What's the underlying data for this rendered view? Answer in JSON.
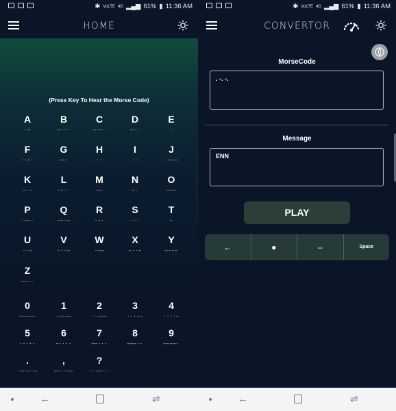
{
  "status": {
    "battery": "61%",
    "time": "11:36 AM",
    "net": "4G",
    "volte": "VoLTE"
  },
  "home": {
    "title": "HOME",
    "hint": "(Press Key To Hear the Morse Code)",
    "keys": [
      {
        "ch": "A",
        "mc": "·−"
      },
      {
        "ch": "B",
        "mc": "−···"
      },
      {
        "ch": "C",
        "mc": "−·−·"
      },
      {
        "ch": "D",
        "mc": "−··"
      },
      {
        "ch": "E",
        "mc": "·"
      },
      {
        "ch": "F",
        "mc": "··−·"
      },
      {
        "ch": "G",
        "mc": "−−·"
      },
      {
        "ch": "H",
        "mc": "····"
      },
      {
        "ch": "I",
        "mc": "··"
      },
      {
        "ch": "J",
        "mc": "·−−−"
      },
      {
        "ch": "K",
        "mc": "−·−"
      },
      {
        "ch": "L",
        "mc": "·−··"
      },
      {
        "ch": "M",
        "mc": "−−"
      },
      {
        "ch": "N",
        "mc": "−·"
      },
      {
        "ch": "O",
        "mc": "−−−"
      },
      {
        "ch": "P",
        "mc": "·−−·"
      },
      {
        "ch": "Q",
        "mc": "−−·−"
      },
      {
        "ch": "R",
        "mc": "·−·"
      },
      {
        "ch": "S",
        "mc": "···"
      },
      {
        "ch": "T",
        "mc": "−"
      },
      {
        "ch": "U",
        "mc": "··−"
      },
      {
        "ch": "V",
        "mc": "···−"
      },
      {
        "ch": "W",
        "mc": "·−−"
      },
      {
        "ch": "X",
        "mc": "−··−"
      },
      {
        "ch": "Y",
        "mc": "−·−−"
      },
      {
        "ch": "Z",
        "mc": "−−··"
      },
      {
        "ch": "0",
        "mc": "−−−−−"
      },
      {
        "ch": "1",
        "mc": "·−−−−"
      },
      {
        "ch": "2",
        "mc": "··−−−"
      },
      {
        "ch": "3",
        "mc": "···−−"
      },
      {
        "ch": "4",
        "mc": "····−"
      },
      {
        "ch": "5",
        "mc": "·····"
      },
      {
        "ch": "6",
        "mc": "−····"
      },
      {
        "ch": "7",
        "mc": "−−···"
      },
      {
        "ch": "8",
        "mc": "−−−··"
      },
      {
        "ch": "9",
        "mc": "−−−−·"
      },
      {
        "ch": ".",
        "mc": "·−·−·−"
      },
      {
        "ch": ",",
        "mc": "−−··−−"
      },
      {
        "ch": "?",
        "mc": "··−−··"
      }
    ]
  },
  "convertor": {
    "title": "CONVERTOR",
    "morse_label": "MorseCode",
    "morse_value": ". -. -.",
    "message_label": "Message",
    "message_value": "ENN",
    "play_label": "PLAY",
    "keys": {
      "back": "←",
      "dot": "●",
      "dash": "–",
      "space": "Space"
    }
  },
  "icons": {
    "menu": "hamburger-icon",
    "theme": "sun-icon",
    "speed": "speedometer-icon",
    "compass": "compass-icon"
  }
}
